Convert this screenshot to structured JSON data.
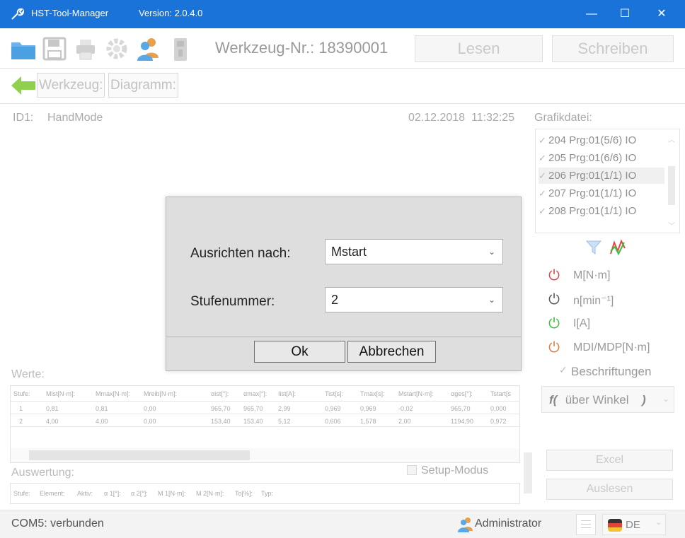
{
  "window": {
    "title": "HST-Tool-Manager",
    "version": "Version: 2.0.4.0",
    "minimize": "—",
    "maximize": "☐",
    "close": "✕"
  },
  "toolbar": {
    "tool_number": "Werkzeug-Nr.: 18390001",
    "read_label": "Lesen",
    "write_label": "Schreiben"
  },
  "nav": {
    "back_arrow": "🡐",
    "tool_tab": "Werkzeug:",
    "diagram_tab": "Diagramm:"
  },
  "info": {
    "id": "ID1:",
    "mode": "HandMode",
    "datetime": "02.12.2018  11:32:25",
    "graphics_file_label": "Grafikdatei:"
  },
  "graphics_list": [
    "204 Prg:01(5/6) IO",
    "205 Prg:01(6/6) IO",
    "206 Prg:01(1/1) IO",
    "207 Prg:01(1/1) IO",
    "208 Prg:01(1/1) IO"
  ],
  "parameters": [
    {
      "label": "M[N·m]",
      "color": "#e0454a"
    },
    {
      "label": "n[min⁻¹]",
      "color": "#666666"
    },
    {
      "label": "I[A]",
      "color": "#3bbf3b"
    },
    {
      "label": "MDI/MDP[N·m]",
      "color": "#e07b3b"
    }
  ],
  "labels_checkbox": "Beschriftungen",
  "function_select": {
    "prefix": "f(",
    "text": " über Winkel",
    "suffix": ")"
  },
  "values_section": {
    "title": "Werte:",
    "headers": [
      "Stufe:",
      "Mist[N·m]:",
      "Mmax[N·m]:",
      "Mreib[N·m]:",
      "αist[°]:",
      "αmax[°]:",
      "Iist[A]:",
      "Tist[s]:",
      "Tmax[s]:",
      "Mstart[N·m]:",
      "αges[°]:",
      "Tstart[s"
    ],
    "rows": [
      [
        "1",
        "0,81",
        "0,81",
        "0,00",
        "965,70",
        "965,70",
        "2,99",
        "0,969",
        "0,969",
        "-0,02",
        "965,70",
        "0,000"
      ],
      [
        "2",
        "4,00",
        "4,00",
        "0,00",
        "153,40",
        "153,40",
        "5,12",
        "0,606",
        "1,578",
        "2,00",
        "1194,90",
        "0,972"
      ]
    ]
  },
  "evaluation_section": {
    "title": "Auswertung:",
    "setup_mode": "Setup-Modus",
    "headers": [
      "Stufe:",
      "Element:",
      "Aktiv:",
      "α 1[°]:",
      "α 2[°]:",
      "M 1[N·m]:",
      "M 2[N·m]:",
      "To[%]:",
      "Typ:"
    ]
  },
  "side_buttons": {
    "excel": "Excel",
    "read_out": "Auslesen"
  },
  "dialog": {
    "align_label": "Ausrichten nach:",
    "align_value": "Mstart",
    "step_label": "Stufenummer:",
    "step_value": "2",
    "ok": "Ok",
    "cancel": "Abbrechen"
  },
  "status": {
    "connection": "COM5: verbunden",
    "user": "Administrator",
    "language": "DE"
  }
}
